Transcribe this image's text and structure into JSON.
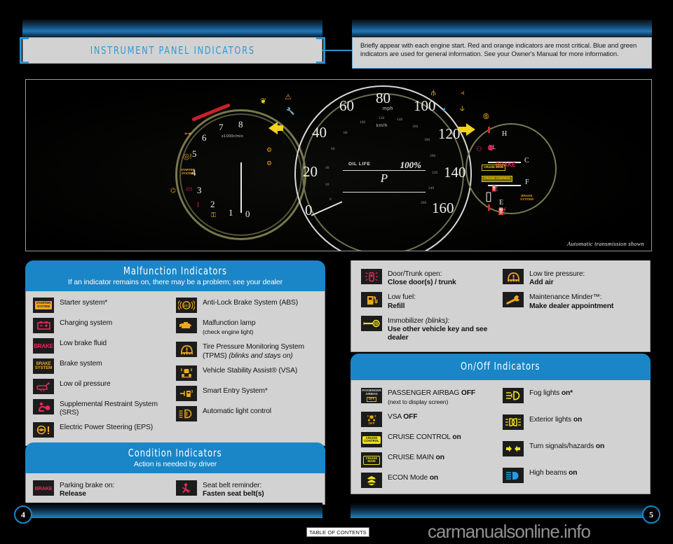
{
  "header": {
    "title": "INSTRUMENT PANEL INDICATORS",
    "intro": "Briefly appear with each engine start. Red and orange indicators are most critical. Blue and green indicators are used for general information. See your Owner's Manual for more information."
  },
  "dashboard": {
    "caption": "Automatic transmission shown",
    "tach": {
      "unit": "x1000r/min",
      "numbers": [
        "0",
        "1",
        "2",
        "3",
        "4",
        "5",
        "6",
        "7",
        "8"
      ]
    },
    "speedo": {
      "unit_mph": "mph",
      "unit_kmh": "km/h",
      "mph_numbers": [
        "0",
        "20",
        "40",
        "60",
        "80",
        "100",
        "120",
        "140",
        "160"
      ],
      "kmh_numbers": [
        "20",
        "40",
        "60",
        "80",
        "100",
        "120",
        "140",
        "160",
        "180",
        "200",
        "220",
        "240",
        "260"
      ]
    },
    "display": {
      "oil_life_label": "OIL LIFE",
      "oil_life_value": "100%",
      "gear": "P"
    },
    "fuel_gauge": {
      "temp_hot": "H",
      "temp_cold": "C",
      "fuel_full": "F",
      "fuel_empty": "E"
    },
    "cluster_badges": {
      "starter_system": "STARTER SYSTEM",
      "brake": "BRAKE",
      "brake_system": "BRAKE SYSTEM",
      "cruise_main": "CRUISE MAIN",
      "cruise_control": "CRUISE CONTROL"
    }
  },
  "malfunction": {
    "title": "Malfunction Indicators",
    "subtitle": "If an indicator remains on, there may be a problem; see your dealer",
    "left": [
      {
        "icon": "starter-system-icon",
        "label": "Starter system*"
      },
      {
        "icon": "battery-charging-icon",
        "label": "Charging system"
      },
      {
        "icon": "brake-fluid-icon",
        "label": "Low brake fluid"
      },
      {
        "icon": "brake-system-icon",
        "label": "Brake system"
      },
      {
        "icon": "oil-pressure-icon",
        "label": "Low oil pressure"
      },
      {
        "icon": "srs-airbag-icon",
        "label": "Supplemental Restraint System (SRS)"
      },
      {
        "icon": "eps-steering-icon",
        "label": "Electric Power Steering (EPS)"
      }
    ],
    "right": [
      {
        "icon": "abs-icon",
        "label": "Anti-Lock Brake System (ABS)"
      },
      {
        "icon": "check-engine-icon",
        "label": "Malfunction lamp",
        "sub": "(check engine light)"
      },
      {
        "icon": "tpms-icon",
        "label": "Tire Pressure Monitoring System (TPMS) ",
        "em": "(blinks and stays on)"
      },
      {
        "icon": "vsa-icon",
        "label": "Vehicle Stability Assist® (VSA)"
      },
      {
        "icon": "smart-entry-icon",
        "label": "Smart Entry System*"
      },
      {
        "icon": "auto-light-icon",
        "label": "Automatic light control"
      }
    ]
  },
  "condition": {
    "title": "Condition Indicators",
    "subtitle": "Action is needed by driver",
    "left": [
      {
        "icon": "parking-brake-icon",
        "label": "Parking brake on:",
        "action": "Release"
      }
    ],
    "right": [
      {
        "icon": "seat-belt-icon",
        "label": "Seat belt reminder:",
        "action": "Fasten seat belt(s)"
      }
    ]
  },
  "info_panel": {
    "left": [
      {
        "icon": "door-trunk-open-icon",
        "label": "Door/Trunk open:",
        "action": "Close door(s) / trunk"
      },
      {
        "icon": "low-fuel-icon",
        "label": "Low fuel:",
        "action": "Refill"
      },
      {
        "icon": "immobilizer-icon",
        "label": "Immobilizer ",
        "em": "(blinks):",
        "action": "Use other vehicle key and see dealer"
      }
    ],
    "right": [
      {
        "icon": "low-tire-pressure-icon",
        "label": "Low tire pressure:",
        "action": "Add air"
      },
      {
        "icon": "maintenance-minder-icon",
        "label": "Maintenance Minder™:",
        "action": "Make dealer appointment"
      }
    ]
  },
  "onoff": {
    "title": "On/Off Indicators",
    "left": [
      {
        "icon": "passenger-airbag-off-icon",
        "label": "PASSENGER AIRBAG ",
        "bold": "OFF",
        "sub": "(next to display screen)"
      },
      {
        "icon": "vsa-off-icon",
        "label": "VSA ",
        "bold": "OFF"
      },
      {
        "icon": "cruise-control-icon",
        "label": "CRUISE CONTROL ",
        "bold": "on"
      },
      {
        "icon": "cruise-main-icon",
        "label": "CRUISE MAIN ",
        "bold": "on"
      },
      {
        "icon": "econ-mode-icon",
        "label": "ECON Mode ",
        "bold": "on"
      }
    ],
    "right": [
      {
        "icon": "fog-lights-icon",
        "label": "Fog lights ",
        "bold": "on*"
      },
      {
        "icon": "exterior-lights-icon",
        "label": "Exterior lights ",
        "bold": "on"
      },
      {
        "icon": "turn-signal-icon",
        "label": "Turn signals/hazards ",
        "bold": "on"
      },
      {
        "icon": "high-beams-icon",
        "label": "High beams ",
        "bold": "on"
      }
    ]
  },
  "footer": {
    "page_left": "4",
    "page_right": "5",
    "toc": "TABLE OF CONTENTS",
    "watermark": "carmanualsonline.info"
  },
  "colors": {
    "accent_blue": "#1a86c8",
    "title_blue": "#2e9ad6",
    "panel_gray": "#d2d2d2",
    "red": "#e82a5c",
    "amber": "#efa81e",
    "yellow": "#f0e01c"
  }
}
